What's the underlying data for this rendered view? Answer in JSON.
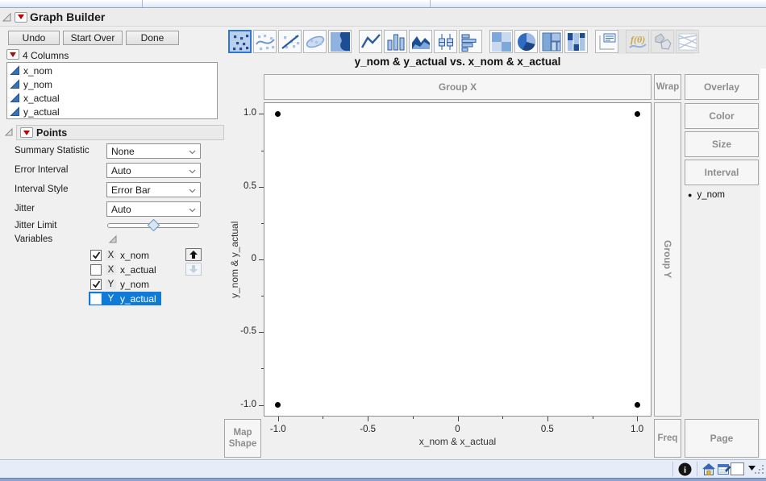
{
  "window": {
    "title": "Graph Builder"
  },
  "buttons": {
    "undo": "Undo",
    "start_over": "Start Over",
    "done": "Done"
  },
  "columns_panel": {
    "header": "4 Columns",
    "items": [
      "x_nom",
      "y_nom",
      "x_actual",
      "y_actual"
    ]
  },
  "points_panel": {
    "title": "Points",
    "controls": [
      {
        "label": "Summary Statistic",
        "value": "None"
      },
      {
        "label": "Error Interval",
        "value": "Auto"
      },
      {
        "label": "Interval Style",
        "value": "Error Bar"
      },
      {
        "label": "Jitter",
        "value": "Auto"
      }
    ],
    "jitter_limit_label": "Jitter Limit",
    "jitter_limit_value_pos": 0.5,
    "variables_label": "Variables",
    "variables": [
      {
        "checked": true,
        "role": "X",
        "name": "x_nom",
        "selected": false,
        "button": "up"
      },
      {
        "checked": false,
        "role": "X",
        "name": "x_actual",
        "selected": false,
        "button": "down-disabled"
      },
      {
        "checked": true,
        "role": "Y",
        "name": "y_nom",
        "selected": false,
        "button": null
      },
      {
        "checked": false,
        "role": "Y",
        "name": "y_actual",
        "selected": true,
        "button": null
      }
    ]
  },
  "graph_type_toolbar": [
    {
      "name": "points",
      "selected": true,
      "group": 1
    },
    {
      "name": "smoother"
    },
    {
      "name": "line-of-fit"
    },
    {
      "name": "ellipse"
    },
    {
      "name": "contour"
    },
    {
      "name": "line",
      "group": 2
    },
    {
      "name": "bar"
    },
    {
      "name": "area"
    },
    {
      "name": "box-plot"
    },
    {
      "name": "histogram"
    },
    {
      "name": "heatmap",
      "group": 3
    },
    {
      "name": "pie"
    },
    {
      "name": "treemap"
    },
    {
      "name": "mosaic"
    },
    {
      "name": "caption-box",
      "group": 4
    },
    {
      "name": "formula",
      "disabled": true,
      "group": 5
    },
    {
      "name": "map-shapes",
      "disabled": true
    },
    {
      "name": "parallel-plot",
      "disabled": true
    }
  ],
  "chart": {
    "zones": {
      "group_x": "Group X",
      "wrap": "Wrap",
      "overlay": "Overlay",
      "color": "Color",
      "size": "Size",
      "interval": "Interval",
      "group_y": "Group Y",
      "map_shape": "Map Shape",
      "freq": "Freq",
      "page": "Page"
    },
    "legend_items": [
      {
        "marker": "●",
        "label": "y_nom"
      }
    ]
  },
  "chart_data": {
    "type": "scatter",
    "title": "y_nom & y_actual vs. x_nom & x_actual",
    "xlabel": "x_nom & x_actual",
    "ylabel": "y_nom & y_actual",
    "xlim": [
      -1.08,
      1.08
    ],
    "ylim": [
      -1.08,
      1.08
    ],
    "x_tick_labels": [
      "-1.0",
      "-0.5",
      "0",
      "0.5",
      "1.0"
    ],
    "y_tick_labels": [
      "1.0",
      "0.5",
      "0",
      "-0.5",
      "-1.0"
    ],
    "x_minor_ticks": [
      -0.75,
      -0.25,
      0.25,
      0.75
    ],
    "y_minor_ticks": [
      -0.75,
      -0.25,
      0.25,
      0.75
    ],
    "grid": false,
    "legend_position": "right",
    "series": [
      {
        "name": "y_nom",
        "marker": "filled-circle",
        "color": "#000000",
        "points": [
          [
            -1,
            1
          ],
          [
            1,
            1
          ],
          [
            -1,
            -1
          ],
          [
            1,
            -1
          ]
        ]
      }
    ]
  },
  "colors": {
    "selection": "#0f7bd7",
    "selected_icon_border": "#2e75d4",
    "red_triangle": "#c00000",
    "marker": "#000000"
  },
  "status_bar": {
    "icons": [
      "info-icon",
      "home-window-icon",
      "journal-icon",
      "selection-color-swatch",
      "dropdown-arrow-icon",
      "resize-grip"
    ]
  }
}
